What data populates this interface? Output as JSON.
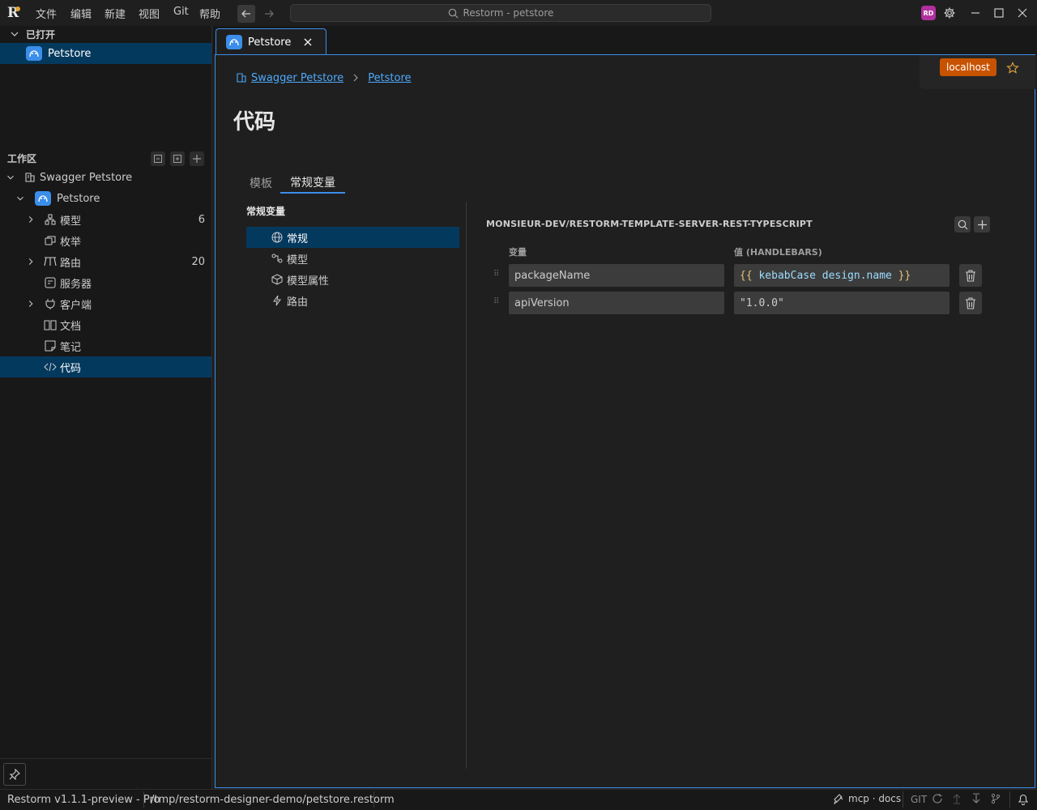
{
  "titlebar": {
    "menu": [
      "文件",
      "编辑",
      "新建",
      "视图",
      "Git",
      "帮助"
    ],
    "search_text": "Restorm - petstore",
    "avatar_initials": "RD"
  },
  "sidebar": {
    "opened_label": "已打开",
    "opened_item": "Petstore",
    "workspace_label": "工作区",
    "root": "Swagger Petstore",
    "project": "Petstore",
    "items": [
      {
        "label": "模型",
        "count": "6",
        "icon": "models-icon",
        "expandable": true
      },
      {
        "label": "枚举",
        "count": "",
        "icon": "enum-icon",
        "expandable": false
      },
      {
        "label": "路由",
        "count": "20",
        "icon": "routes-icon",
        "expandable": true
      },
      {
        "label": "服务器",
        "count": "",
        "icon": "server-icon",
        "expandable": false
      },
      {
        "label": "客户端",
        "count": "",
        "icon": "client-icon",
        "expandable": true
      },
      {
        "label": "文档",
        "count": "",
        "icon": "docs-icon",
        "expandable": false
      },
      {
        "label": "笔记",
        "count": "",
        "icon": "notes-icon",
        "expandable": false
      },
      {
        "label": "代码",
        "count": "",
        "icon": "code-icon",
        "expandable": false
      }
    ]
  },
  "editor": {
    "tab_label": "Petstore",
    "server_label": "localhost",
    "breadcrumb": [
      "Swagger Petstore",
      "Petstore"
    ],
    "page_title": "代码",
    "tabs": [
      "模板",
      "常规变量"
    ],
    "subnav_title": "常规变量",
    "subnav_items": [
      "常规",
      "模型",
      "模型属性",
      "路由"
    ],
    "repo_title": "MONSIEUR-DEV/RESTORM-TEMPLATE-SERVER-REST-TYPESCRIPT",
    "col_variable": "变量",
    "col_value": "值 (HANDLEBARS)",
    "variables": [
      {
        "name": "packageName",
        "value_open": "{{",
        "value_body": " kebabCase design.name ",
        "value_close": "}}"
      },
      {
        "name": "apiVersion",
        "value_plain": "\"1.0.0\""
      }
    ]
  },
  "statusbar": {
    "version": "Restorm v1.1.1-preview - Pro",
    "path": "/tmp/restorm-designer-demo/petstore.restorm",
    "mcp": "mcp · docs",
    "git": "GIT"
  },
  "colors": {
    "accent": "#3b8eea",
    "selection": "#04395e",
    "server_badge": "#c75300",
    "handlebars_brace": "#e5c07b",
    "handlebars_expr": "#9cdcfe"
  }
}
